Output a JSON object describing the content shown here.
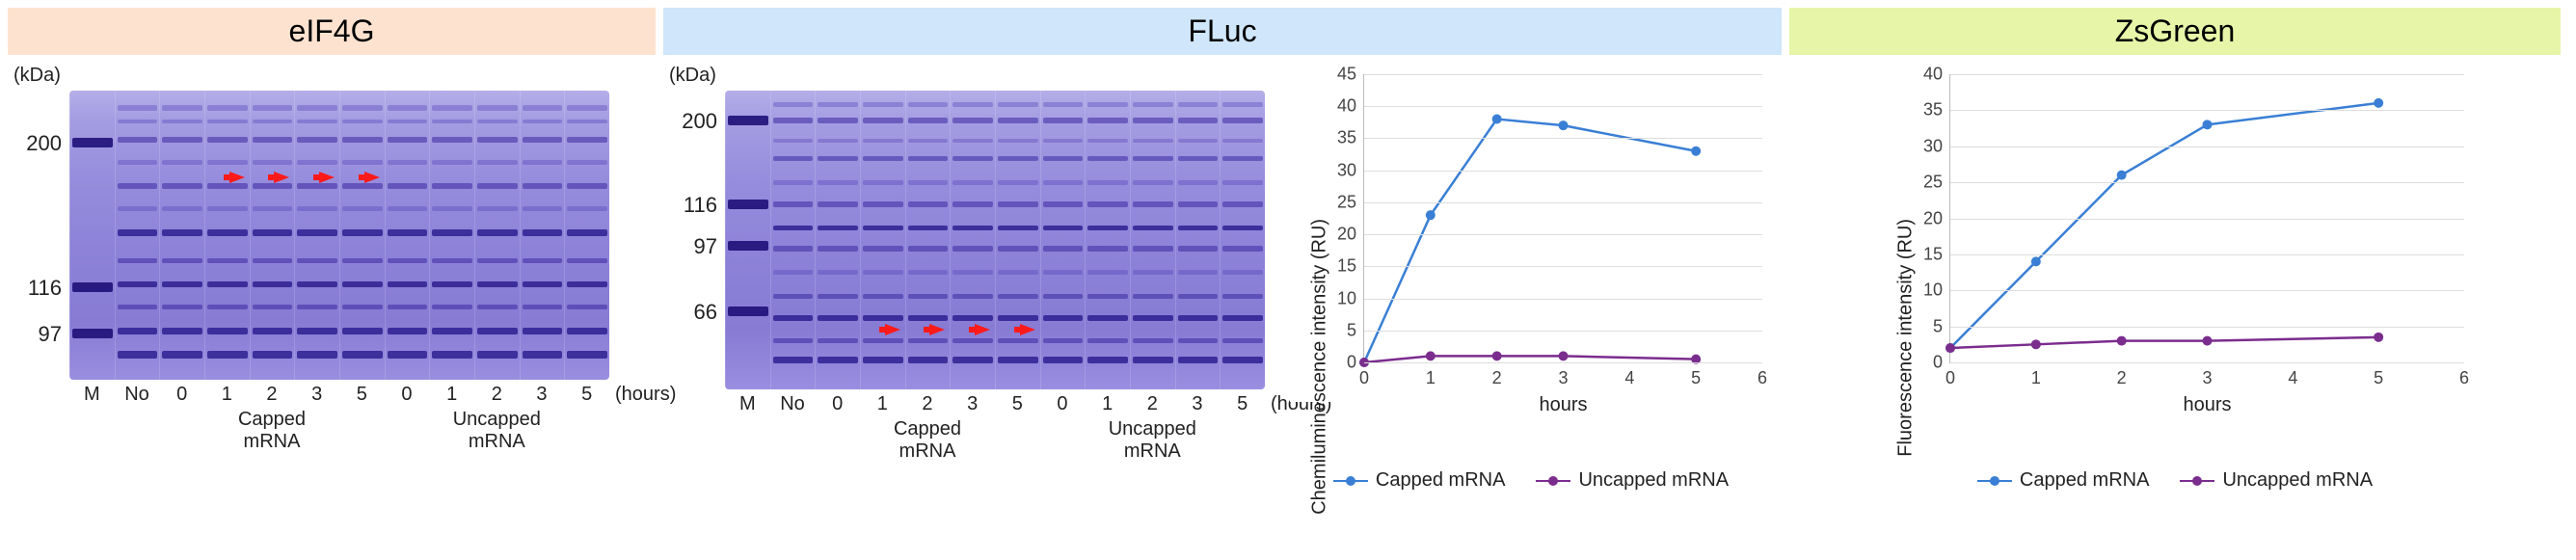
{
  "panels": {
    "eif4g": {
      "title": "eIF4G",
      "units": "(kDa)"
    },
    "fluc": {
      "title": "FLuc",
      "units": "(kDa)"
    },
    "zsgreen": {
      "title": "ZsGreen"
    }
  },
  "gel_eif4g": {
    "mw_markers": [
      "200",
      "116",
      "97"
    ],
    "mw_positions_pct": [
      18,
      68,
      84
    ],
    "lanes": [
      "M",
      "No",
      "0",
      "1",
      "2",
      "3",
      "5",
      "0",
      "1",
      "2",
      "3",
      "5"
    ],
    "hours_label": "(hours)",
    "group_capped": "Capped\nmRNA",
    "group_uncapped": "Uncapped\nmRNA",
    "arrow_lanes": [
      3,
      4,
      5,
      6
    ],
    "arrow_y_pct": 30
  },
  "gel_fluc": {
    "mw_markers": [
      "200",
      "116",
      "97",
      "66"
    ],
    "mw_positions_pct": [
      10,
      38,
      52,
      74
    ],
    "lanes": [
      "M",
      "No",
      "0",
      "1",
      "2",
      "3",
      "5",
      "0",
      "1",
      "2",
      "3",
      "5"
    ],
    "hours_label": "(hours)",
    "group_capped": "Capped\nmRNA",
    "group_uncapped": "Uncapped\nmRNA",
    "arrow_lanes": [
      3,
      4,
      5,
      6
    ],
    "arrow_y_pct": 80
  },
  "chart_data": [
    {
      "id": "fluc_chart",
      "type": "line",
      "x": [
        0,
        1,
        2,
        3,
        5
      ],
      "series": [
        {
          "name": "Capped mRNA",
          "values": [
            0,
            23,
            38,
            37,
            33
          ],
          "color": "#3a7fd5"
        },
        {
          "name": "Uncapped mRNA",
          "values": [
            0,
            1,
            1,
            1,
            0.5
          ],
          "color": "#7b2d8e"
        }
      ],
      "xlabel": "hours",
      "ylabel": "Chemiluminescence intensity (RU)",
      "xlim": [
        0,
        6
      ],
      "ylim": [
        0,
        45
      ],
      "yticks": [
        0,
        5,
        10,
        15,
        20,
        25,
        30,
        35,
        40,
        45
      ],
      "xticks": [
        0,
        1,
        2,
        3,
        4,
        5,
        6
      ]
    },
    {
      "id": "zsgreen_chart",
      "type": "line",
      "x": [
        0,
        1,
        2,
        3,
        5
      ],
      "series": [
        {
          "name": "Capped mRNA",
          "values": [
            2,
            14,
            26,
            33,
            36
          ],
          "color": "#3a7fd5"
        },
        {
          "name": "Uncapped mRNA",
          "values": [
            2,
            2.5,
            3,
            3,
            3.5
          ],
          "color": "#7b2d8e"
        }
      ],
      "xlabel": "hours",
      "ylabel": "Fluorescence intensity (RU)",
      "xlim": [
        0,
        6
      ],
      "ylim": [
        0,
        40
      ],
      "yticks": [
        0,
        5,
        10,
        15,
        20,
        25,
        30,
        35,
        40
      ],
      "xticks": [
        0,
        1,
        2,
        3,
        4,
        5,
        6
      ]
    }
  ],
  "legend_labels": {
    "capped": "Capped mRNA",
    "uncapped": "Uncapped mRNA"
  }
}
